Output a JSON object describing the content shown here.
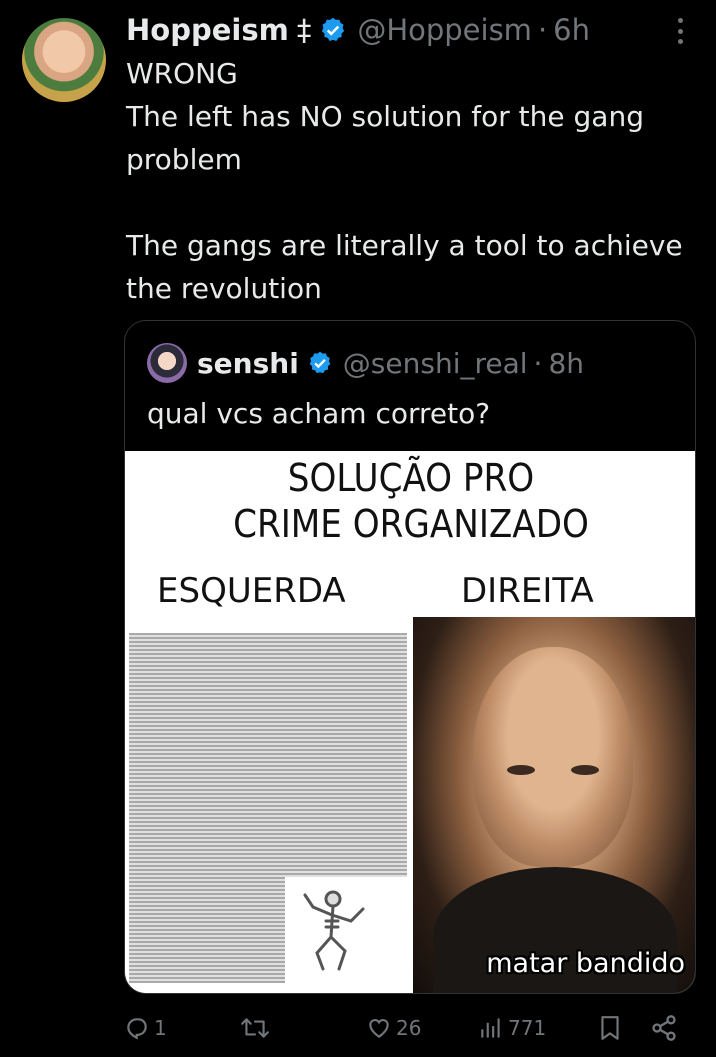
{
  "tweet": {
    "author_name": "Hoppeism",
    "author_mark": "‡",
    "handle": "@Hoppeism",
    "separator": "·",
    "time": "6h",
    "text": "WRONG\nThe left has NO solution for the gang problem\n\nThe gangs are literally a tool to achieve the revolution"
  },
  "quote": {
    "author_name": "senshi",
    "handle": "@senshi_real",
    "separator": "·",
    "time": "8h",
    "text": "qual vcs acham correto?",
    "meme": {
      "title": "SOLUÇÃO PRO\nCRIME ORGANIZADO",
      "left_label": "ESQUERDA",
      "right_label": "DIREITA",
      "caption": "matar bandido"
    }
  },
  "actions": {
    "replies": "1",
    "retweets": "",
    "likes": "26",
    "views": "771"
  },
  "colors": {
    "background": "#000000",
    "text": "#e7e9ea",
    "muted": "#71767b",
    "verified": "#1d9bf0",
    "border": "#2f3336"
  },
  "icons": [
    "verified-badge-icon",
    "more-icon",
    "reply-icon",
    "retweet-icon",
    "like-icon",
    "views-icon",
    "bookmark-icon",
    "share-icon"
  ]
}
